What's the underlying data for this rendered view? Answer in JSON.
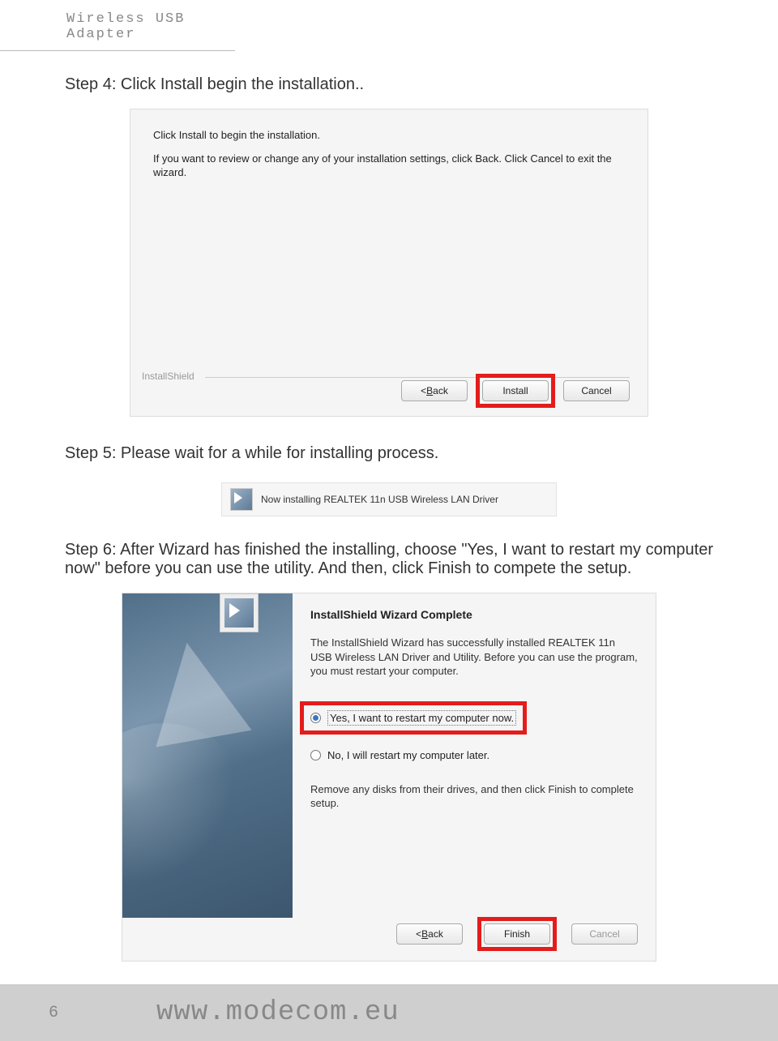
{
  "header": {
    "title": "Wireless USB Adapter"
  },
  "step4": {
    "text": "Step 4: Click Install begin the installation.."
  },
  "dialog1": {
    "line1": "Click Install to begin the installation.",
    "line2": "If you want to review or change any of your installation settings, click Back. Click Cancel to exit the wizard.",
    "legend": "InstallShield",
    "back_prefix": "< ",
    "back_u": "B",
    "back_rest": "ack",
    "install": "Install",
    "cancel": "Cancel"
  },
  "step5": {
    "text": "Step 5: Please wait for a while for installing process."
  },
  "progress": {
    "text": "Now installing REALTEK 11n USB Wireless LAN Driver"
  },
  "step6": {
    "text": "Step 6: After Wizard has finished the installing, choose \"Yes, I want to restart my computer now\" before you can use the utility. And then, click Finish to compete the setup."
  },
  "dialog2": {
    "title": "InstallShield Wizard Complete",
    "para": "The InstallShield Wizard has successfully installed REALTEK 11n USB Wireless LAN Driver and Utility.  Before you can use the program, you must restart your computer.",
    "radio_yes": "Yes, I want to restart my computer now.",
    "radio_no": "No, I will restart my computer later.",
    "para2": "Remove any disks from their drives, and then click Finish to complete setup.",
    "back_prefix": "< ",
    "back_u": "B",
    "back_rest": "ack",
    "finish": "Finish",
    "cancel": "Cancel"
  },
  "footer": {
    "page": "6",
    "url": "www.modecom.eu"
  }
}
